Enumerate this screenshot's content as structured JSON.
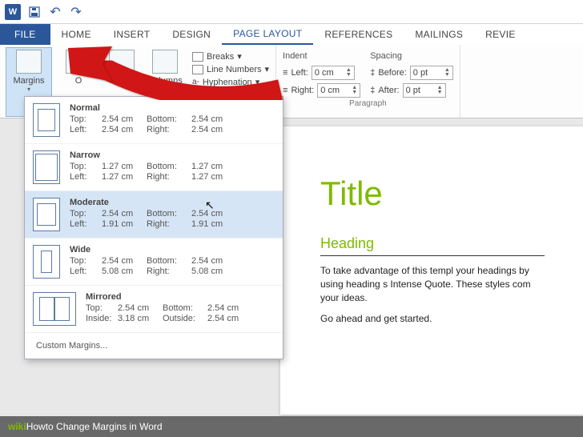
{
  "tabs": {
    "file": "FILE",
    "home": "HOME",
    "insert": "INSERT",
    "design": "DESIGN",
    "layout": "PAGE LAYOUT",
    "references": "REFERENCES",
    "mailings": "MAILINGS",
    "review": "REVIE"
  },
  "ribbon": {
    "margins": "Margins",
    "orientation": "O",
    "columns": "Columns",
    "breaks": "Breaks",
    "lineNumbers": "Line Numbers",
    "hyphenation": "Hyphenation",
    "indent": {
      "header": "Indent",
      "leftLabel": "Left:",
      "leftValue": "0 cm",
      "rightLabel": "Right:",
      "rightValue": "0 cm"
    },
    "spacing": {
      "header": "Spacing",
      "beforeLabel": "Before:",
      "beforeValue": "0 pt",
      "afterLabel": "After:",
      "afterValue": "0 pt"
    },
    "paragraphLabel": "Paragraph"
  },
  "marginsMenu": {
    "options": [
      {
        "name": "Normal",
        "t": "2.54 cm",
        "b": "2.54 cm",
        "l": "2.54 cm",
        "r": "2.54 cm",
        "labL": "Left:",
        "labR": "Right:"
      },
      {
        "name": "Narrow",
        "t": "1.27 cm",
        "b": "1.27 cm",
        "l": "1.27 cm",
        "r": "1.27 cm",
        "labL": "Left:",
        "labR": "Right:"
      },
      {
        "name": "Moderate",
        "t": "2.54 cm",
        "b": "2.54 cm",
        "l": "1.91 cm",
        "r": "1.91 cm",
        "labL": "Left:",
        "labR": "Right:"
      },
      {
        "name": "Wide",
        "t": "2.54 cm",
        "b": "2.54 cm",
        "l": "5.08 cm",
        "r": "5.08 cm",
        "labL": "Left:",
        "labR": "Right:"
      },
      {
        "name": "Mirrored",
        "t": "2.54 cm",
        "b": "2.54 cm",
        "l": "3.18 cm",
        "r": "2.54 cm",
        "labL": "Inside:",
        "labR": "Outside:"
      }
    ],
    "topLabel": "Top:",
    "bottomLabel": "Bottom:",
    "custom": "Custom Margins..."
  },
  "doc": {
    "title": "Title",
    "heading": "Heading",
    "p1": "To take advantage of this templ your headings by using heading s Intense Quote. These styles com your ideas.",
    "p2": "Go ahead and get started."
  },
  "footer": {
    "brand": "wiki",
    "how": "How",
    "rest": " to Change Margins in Word"
  }
}
